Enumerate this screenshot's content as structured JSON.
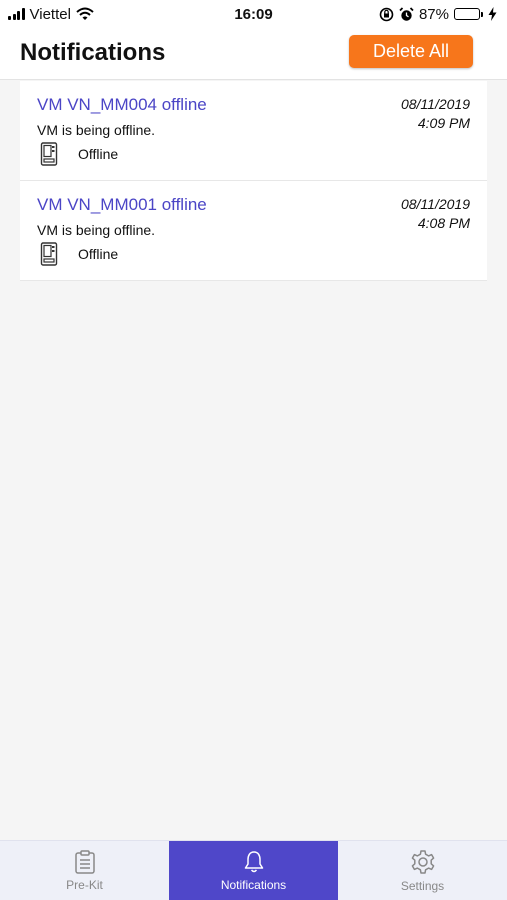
{
  "status_bar": {
    "carrier": "Viettel",
    "time": "16:09",
    "battery_percent": "87%",
    "battery_level": 0.87
  },
  "header": {
    "title": "Notifications",
    "delete_all_label": "Delete All"
  },
  "notifications": [
    {
      "title": "VM VN_MM004 offline",
      "description": "VM is being offline.",
      "status": "Offline",
      "date": "08/11/2019",
      "time": "4:09 PM"
    },
    {
      "title": "VM VN_MM001 offline",
      "description": "VM is being offline.",
      "status": "Offline",
      "date": "08/11/2019",
      "time": "4:08 PM"
    }
  ],
  "tabs": [
    {
      "label": "Pre-Kit",
      "icon": "clipboard-icon",
      "active": false
    },
    {
      "label": "Notifications",
      "icon": "bell-icon",
      "active": true
    },
    {
      "label": "Settings",
      "icon": "gear-icon",
      "active": false
    }
  ],
  "colors": {
    "accent": "#4f47c9",
    "title_link": "#4b45c6",
    "delete_button": "#f7761b",
    "battery": "#4cd964"
  }
}
